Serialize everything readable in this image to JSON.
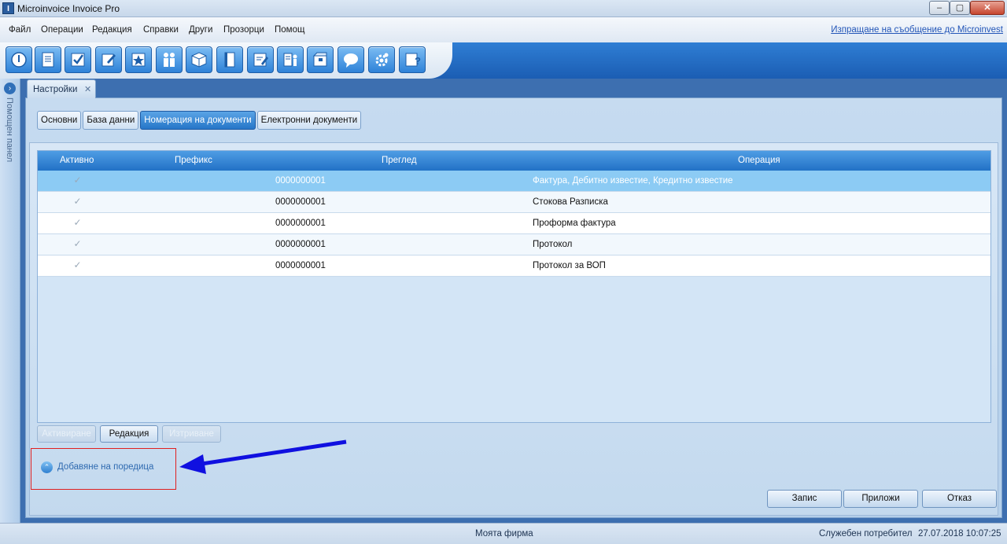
{
  "window": {
    "title": "Microinvoice Invoice Pro",
    "icon_letter": "I",
    "minimize": "‒",
    "maximize": "▢",
    "close": "✕"
  },
  "menu": {
    "items": [
      "Файл",
      "Операции",
      "Редакция",
      "Справки",
      "Други",
      "Прозорци",
      "Помощ"
    ],
    "link": "Изпращане на съобщение до Microinvest"
  },
  "toolbar": {
    "icons": [
      "power-icon",
      "document-icon",
      "checkbox-icon",
      "edit-icon",
      "star-icon",
      "people-icon",
      "box-icon",
      "book-icon",
      "note-edit-icon",
      "person-list-icon",
      "package-icon",
      "chat-icon",
      "settings-gear-icon",
      "help-icon"
    ]
  },
  "help_panel": {
    "label": "Помощен панел",
    "arrow": "›"
  },
  "doc_tab": {
    "label": "Настройки",
    "close": "✕"
  },
  "subtabs": [
    "Основни",
    "База данни",
    "Номерация на документи",
    "Електронни документи"
  ],
  "active_subtab": 2,
  "grid": {
    "columns": [
      "Активно",
      "Префикс",
      "Преглед",
      "Операция"
    ],
    "rows": [
      {
        "active": true,
        "prefix": "",
        "preview": "0000000001",
        "operation": "Фактура, Дебитно известие, Кредитно известие",
        "selected": true
      },
      {
        "active": true,
        "prefix": "",
        "preview": "0000000001",
        "operation": "Стокова Разписка",
        "selected": false
      },
      {
        "active": true,
        "prefix": "",
        "preview": "0000000001",
        "operation": "Проформа фактура",
        "selected": false
      },
      {
        "active": true,
        "prefix": "",
        "preview": "0000000001",
        "operation": "Протокол",
        "selected": false
      },
      {
        "active": true,
        "prefix": "",
        "preview": "0000000001",
        "operation": "Протокол за ВОП",
        "selected": false
      }
    ]
  },
  "actions": {
    "activate": "Активиране",
    "edit": "Редакция",
    "delete": "Изтриване"
  },
  "add_series": {
    "label": "Добавяне на поредица",
    "icon": "⌃"
  },
  "dialog": {
    "save": "Запис",
    "apply": "Приложи",
    "cancel": "Отказ"
  },
  "status": {
    "company": "Моята фирма",
    "user": "Служебен потребител",
    "datetime": "27.07.2018 10:07:25"
  },
  "colors": {
    "accent": "#2271c6",
    "selected_row": "#8ccbf4",
    "annotation_arrow": "#1010e0",
    "annotation_box": "#e02020"
  }
}
